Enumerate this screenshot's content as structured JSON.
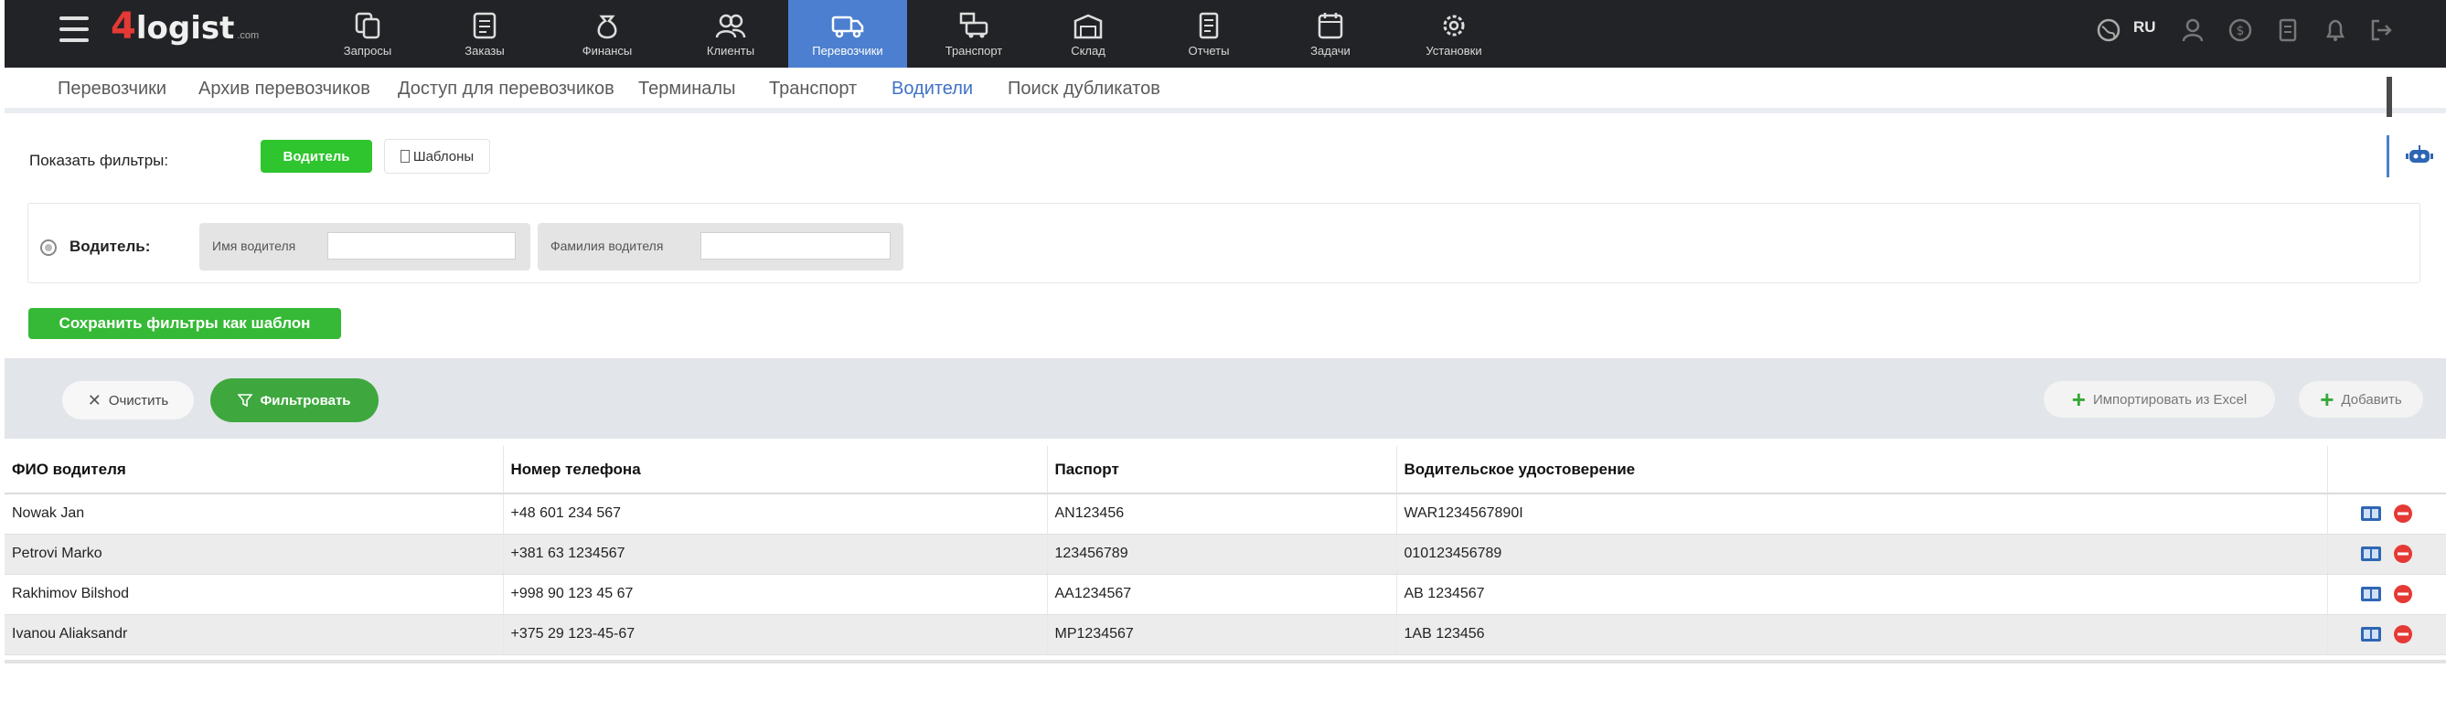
{
  "header": {
    "logo_number": "4",
    "logo_text": "logist",
    "logo_suffix": ".com",
    "nav": [
      {
        "label": "Запросы",
        "icon": "requests-icon"
      },
      {
        "label": "Заказы",
        "icon": "orders-icon"
      },
      {
        "label": "Финансы",
        "icon": "finance-icon"
      },
      {
        "label": "Клиенты",
        "icon": "clients-icon"
      },
      {
        "label": "Перевозчики",
        "icon": "carriers-truck-icon",
        "active": true
      },
      {
        "label": "Транспорт",
        "icon": "transport-icon"
      },
      {
        "label": "Склад",
        "icon": "warehouse-icon"
      },
      {
        "label": "Отчеты",
        "icon": "reports-icon"
      },
      {
        "label": "Задачи",
        "icon": "tasks-icon"
      },
      {
        "label": "Установки",
        "icon": "settings-gear-icon"
      }
    ],
    "lang": "RU"
  },
  "subnav": {
    "items": [
      "Перевозчики",
      "Архив перевозчиков",
      "Доступ для перевозчиков",
      "Терминалы",
      "Транспорт",
      "Водители",
      "Поиск дубликатов"
    ],
    "active": "Водители"
  },
  "filters": {
    "show_label": "Показать фильтры:",
    "drivers_btn": "Водитель",
    "templates_btn": "Шаблоны",
    "driver_label": "Водитель:",
    "first_name_label": "Имя водителя",
    "first_name_value": "",
    "last_name_label": "Фамилия водителя",
    "last_name_value": "",
    "save_btn": "Сохранить фильтры как шаблон"
  },
  "actions": {
    "clear": "Очистить",
    "filter": "Фильтровать",
    "import": "Импортировать из Excel",
    "add": "Добавить"
  },
  "table": {
    "columns": [
      "ФИО водителя",
      "Номер телефона",
      "Паспорт",
      "Водительское удостоверение",
      ""
    ],
    "rows": [
      [
        "Nowak Jan",
        "+48 601 234 567",
        "AN123456",
        "WAR1234567890I"
      ],
      [
        "Petrovi Marko",
        "+381 63 1234567",
        "123456789",
        "010123456789"
      ],
      [
        "Rakhimov Bilshod",
        "+998 90 123 45 67",
        "AA1234567",
        "AB 1234567"
      ],
      [
        "Ivanou Aliaksandr",
        "+375 29 123-45-67",
        "MP1234567",
        "1AB 123456"
      ]
    ]
  },
  "colors": {
    "topbar": "#222326",
    "active_nav": "#4c7fcf",
    "green": "#2ec52e",
    "delete_red": "#e53935",
    "edit_blue": "#2f66b3"
  }
}
